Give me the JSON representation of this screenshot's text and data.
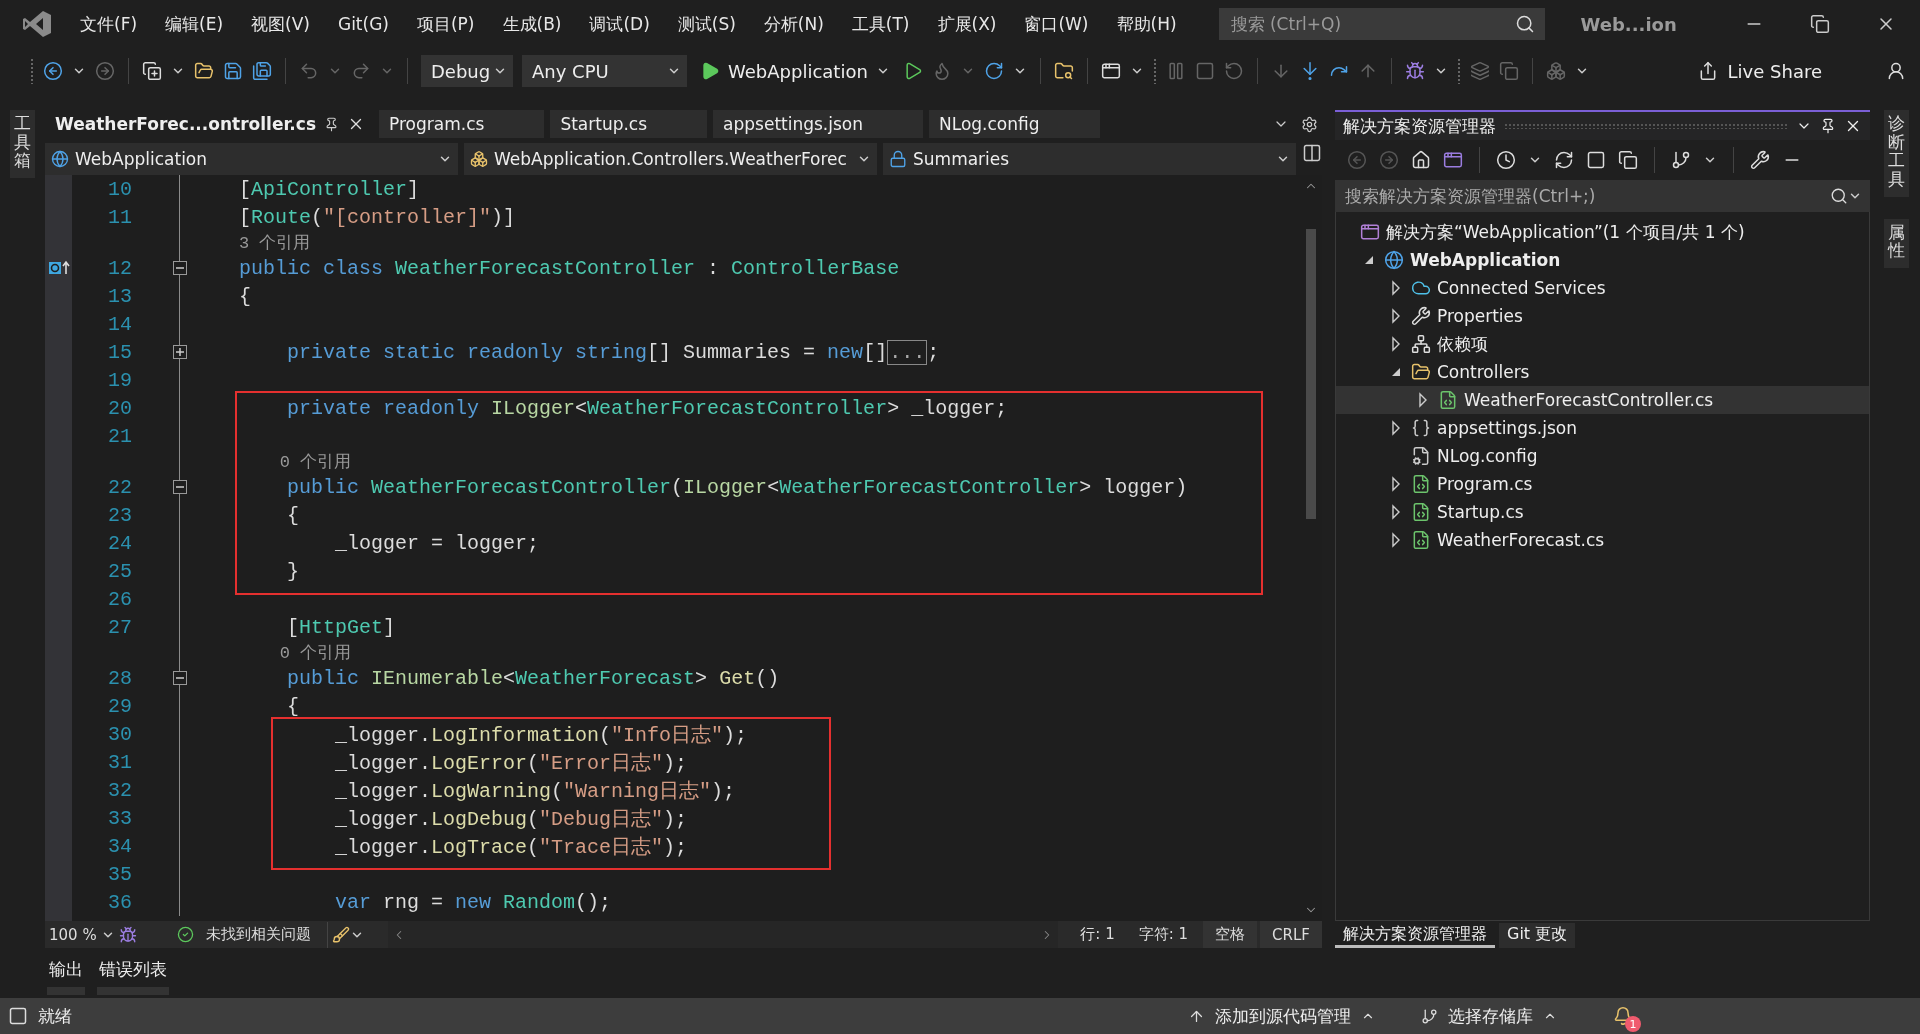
{
  "window": {
    "title": "Web...ion"
  },
  "menu": [
    "文件(F)",
    "编辑(E)",
    "视图(V)",
    "Git(G)",
    "项目(P)",
    "生成(B)",
    "调试(D)",
    "测试(S)",
    "分析(N)",
    "工具(T)",
    "扩展(X)",
    "窗口(W)",
    "帮助(H)"
  ],
  "search": {
    "placeholder": "搜索 (Ctrl+Q)"
  },
  "toolbar": {
    "configuration": "Debug",
    "platform": "Any CPU",
    "start": "WebApplication",
    "live_share": "Live Share"
  },
  "left_rail": [
    "工具箱"
  ],
  "right_rail": [
    "诊断工具",
    "属性"
  ],
  "doc_tabs": [
    {
      "label": "WeatherForec...ontroller.cs",
      "selected": true
    },
    {
      "label": "Program.cs",
      "selected": false
    },
    {
      "label": "Startup.cs",
      "selected": false
    },
    {
      "label": "appsettings.json",
      "selected": false
    },
    {
      "label": "NLog.config",
      "selected": false
    }
  ],
  "nav_bar": {
    "project": "WebApplication",
    "type": "WebApplication.Controllers.WeatherForec",
    "member": "Summaries"
  },
  "code": {
    "blocks": [
      {
        "kind": "plain",
        "rows": [
          {
            "kind": "code",
            "number": "10",
            "tokens": [
              {
                "kind": "plain",
                "text": "["
              },
              {
                "kind": "type",
                "text": "ApiController"
              },
              {
                "kind": "plain",
                "text": "]"
              }
            ]
          },
          {
            "kind": "code",
            "number": "11",
            "tokens": [
              {
                "kind": "plain",
                "text": "["
              },
              {
                "kind": "type",
                "text": "Route"
              },
              {
                "kind": "plain",
                "text": "("
              },
              {
                "kind": "string",
                "text": "\"[controller]\""
              },
              {
                "kind": "plain",
                "text": ")]"
              }
            ]
          },
          {
            "kind": "lens",
            "text": "3 个引用"
          },
          {
            "kind": "code",
            "number": "12",
            "marker": true,
            "folded": false,
            "tokens": [
              {
                "kind": "keyword",
                "text": "public class "
              },
              {
                "kind": "type",
                "text": "WeatherForecastController"
              },
              {
                "kind": "plain",
                "text": " : "
              },
              {
                "kind": "type",
                "text": "ControllerBase"
              }
            ]
          },
          {
            "kind": "code",
            "number": "13",
            "tokens": [
              {
                "kind": "plain",
                "text": "{"
              }
            ]
          },
          {
            "kind": "code",
            "number": "14"
          },
          {
            "kind": "code",
            "number": "15",
            "folded": true,
            "tokens": [
              {
                "kind": "keyword",
                "text": "    private static readonly string"
              },
              {
                "kind": "plain",
                "text": "[] Summaries = "
              },
              {
                "kind": "keyword",
                "text": "new"
              },
              {
                "kind": "plain",
                "text": "[]"
              },
              {
                "kind": "collapsed",
                "text": "..."
              },
              {
                "kind": "plain",
                "text": ";"
              }
            ]
          },
          {
            "kind": "code",
            "number": "19"
          }
        ]
      },
      {
        "kind": "boxed",
        "rows": [
          {
            "kind": "code",
            "number": "20",
            "tokens": [
              {
                "kind": "keyword",
                "text": "    private readonly "
              },
              {
                "kind": "interface",
                "text": "ILogger"
              },
              {
                "kind": "plain",
                "text": "<"
              },
              {
                "kind": "type",
                "text": "WeatherForecastController"
              },
              {
                "kind": "plain",
                "text": "> _logger;"
              }
            ]
          },
          {
            "kind": "code",
            "number": "21"
          },
          {
            "kind": "lens",
            "text": "0 个引用"
          },
          {
            "kind": "code",
            "number": "22",
            "folded": false,
            "tokens": [
              {
                "kind": "keyword",
                "text": "    public "
              },
              {
                "kind": "type",
                "text": "WeatherForecastController"
              },
              {
                "kind": "plain",
                "text": "("
              },
              {
                "kind": "interface",
                "text": "ILogger"
              },
              {
                "kind": "plain",
                "text": "<"
              },
              {
                "kind": "type",
                "text": "WeatherForecastController"
              },
              {
                "kind": "plain",
                "text": "> logger)"
              }
            ]
          },
          {
            "kind": "code",
            "number": "23",
            "tokens": [
              {
                "kind": "plain",
                "text": "    {"
              }
            ]
          },
          {
            "kind": "code",
            "number": "24",
            "tokens": [
              {
                "kind": "plain",
                "text": "        _logger = logger;"
              }
            ]
          },
          {
            "kind": "code",
            "number": "25",
            "tokens": [
              {
                "kind": "plain",
                "text": "    }"
              }
            ]
          }
        ]
      },
      {
        "kind": "plain",
        "rows": [
          {
            "kind": "code",
            "number": "26"
          },
          {
            "kind": "code",
            "number": "27",
            "tokens": [
              {
                "kind": "plain",
                "text": "    ["
              },
              {
                "kind": "type",
                "text": "HttpGet"
              },
              {
                "kind": "plain",
                "text": "]"
              }
            ]
          },
          {
            "kind": "lens",
            "text": "0 个引用"
          },
          {
            "kind": "code",
            "number": "28",
            "folded": false,
            "tokens": [
              {
                "kind": "keyword",
                "text": "    public "
              },
              {
                "kind": "interface",
                "text": "IEnumerable"
              },
              {
                "kind": "plain",
                "text": "<"
              },
              {
                "kind": "type",
                "text": "WeatherForecast"
              },
              {
                "kind": "plain",
                "text": "> "
              },
              {
                "kind": "method",
                "text": "Get"
              },
              {
                "kind": "plain",
                "text": "()"
              }
            ]
          },
          {
            "kind": "code",
            "number": "29",
            "tokens": [
              {
                "kind": "plain",
                "text": "    {"
              }
            ]
          }
        ]
      },
      {
        "kind": "boxed",
        "rows": [
          {
            "kind": "code",
            "number": "30",
            "tokens": [
              {
                "kind": "plain",
                "text": "        _logger."
              },
              {
                "kind": "method",
                "text": "LogInformation"
              },
              {
                "kind": "plain",
                "text": "("
              },
              {
                "kind": "string",
                "text": "\"Info日志\""
              },
              {
                "kind": "plain",
                "text": ");"
              }
            ]
          },
          {
            "kind": "code",
            "number": "31",
            "tokens": [
              {
                "kind": "plain",
                "text": "        _logger."
              },
              {
                "kind": "method",
                "text": "LogError"
              },
              {
                "kind": "plain",
                "text": "("
              },
              {
                "kind": "string",
                "text": "\"Error日志\""
              },
              {
                "kind": "plain",
                "text": ");"
              }
            ]
          },
          {
            "kind": "code",
            "number": "32",
            "tokens": [
              {
                "kind": "plain",
                "text": "        _logger."
              },
              {
                "kind": "method",
                "text": "LogWarning"
              },
              {
                "kind": "plain",
                "text": "("
              },
              {
                "kind": "string",
                "text": "\"Warning日志\""
              },
              {
                "kind": "plain",
                "text": ");"
              }
            ]
          },
          {
            "kind": "code",
            "number": "33",
            "tokens": [
              {
                "kind": "plain",
                "text": "        _logger."
              },
              {
                "kind": "method",
                "text": "LogDebug"
              },
              {
                "kind": "plain",
                "text": "("
              },
              {
                "kind": "string",
                "text": "\"Debug日志\""
              },
              {
                "kind": "plain",
                "text": ");"
              }
            ]
          },
          {
            "kind": "code",
            "number": "34",
            "tokens": [
              {
                "kind": "plain",
                "text": "        _logger."
              },
              {
                "kind": "method",
                "text": "LogTrace"
              },
              {
                "kind": "plain",
                "text": "("
              },
              {
                "kind": "string",
                "text": "\"Trace日志\""
              },
              {
                "kind": "plain",
                "text": ");"
              }
            ]
          }
        ]
      },
      {
        "kind": "plain",
        "rows": [
          {
            "kind": "code",
            "number": "35"
          },
          {
            "kind": "code",
            "number": "36",
            "tokens": [
              {
                "kind": "keyword",
                "text": "        var "
              },
              {
                "kind": "plain",
                "text": "rng = "
              },
              {
                "kind": "keyword",
                "text": "new "
              },
              {
                "kind": "type",
                "text": "Random"
              },
              {
                "kind": "plain",
                "text": "();"
              }
            ]
          }
        ]
      }
    ]
  },
  "editor_status": {
    "zoom": "100 %",
    "issues": "未找到相关问题",
    "line": "行: 1",
    "column": "字符: 1",
    "whitespace": "空格",
    "line_ending": "CRLF"
  },
  "bottom_tabs": [
    {
      "label": "输出",
      "selected": false
    },
    {
      "label": "错误列表",
      "selected": false
    }
  ],
  "solution_explorer": {
    "title": "解决方案资源管理器",
    "search": {
      "placeholder": "搜索解决方案资源管理器(Ctrl+;)"
    },
    "tree": [
      {
        "kind": "solution",
        "label": "解决方案“WebApplication”(1 个项目/共 1 个)",
        "selected": false,
        "children": [
          {
            "kind": "project",
            "label": "WebApplication",
            "expanded": true,
            "selected": false,
            "children": [
              {
                "kind": "connected",
                "label": "Connected Services",
                "expanded": false,
                "selected": false
              },
              {
                "kind": "properties",
                "label": "Properties",
                "expanded": false,
                "selected": false
              },
              {
                "kind": "dependencies",
                "label": "依赖项",
                "expanded": false,
                "selected": false
              },
              {
                "kind": "folder",
                "label": "Controllers",
                "expanded": true,
                "selected": false,
                "children": [
                  {
                    "kind": "csharp",
                    "label": "WeatherForecastController.cs",
                    "expanded": false,
                    "selected": true
                  }
                ]
              },
              {
                "kind": "json",
                "label": "appsettings.json",
                "expanded": false,
                "selected": false
              },
              {
                "kind": "config",
                "label": "NLog.config",
                "selected": false
              },
              {
                "kind": "csharp",
                "label": "Program.cs",
                "expanded": false,
                "selected": false
              },
              {
                "kind": "csharp",
                "label": "Startup.cs",
                "expanded": false,
                "selected": false
              },
              {
                "kind": "csharp",
                "label": "WeatherForecast.cs",
                "expanded": false,
                "selected": false
              }
            ]
          }
        ]
      }
    ],
    "tabs": [
      {
        "label": "解决方案资源管理器",
        "selected": true
      },
      {
        "label": "Git 更改",
        "selected": false
      }
    ]
  },
  "status_bar": {
    "state": "就绪",
    "source_control": "添加到源代码管理",
    "repository": "选择存储库",
    "notifications": "1"
  }
}
